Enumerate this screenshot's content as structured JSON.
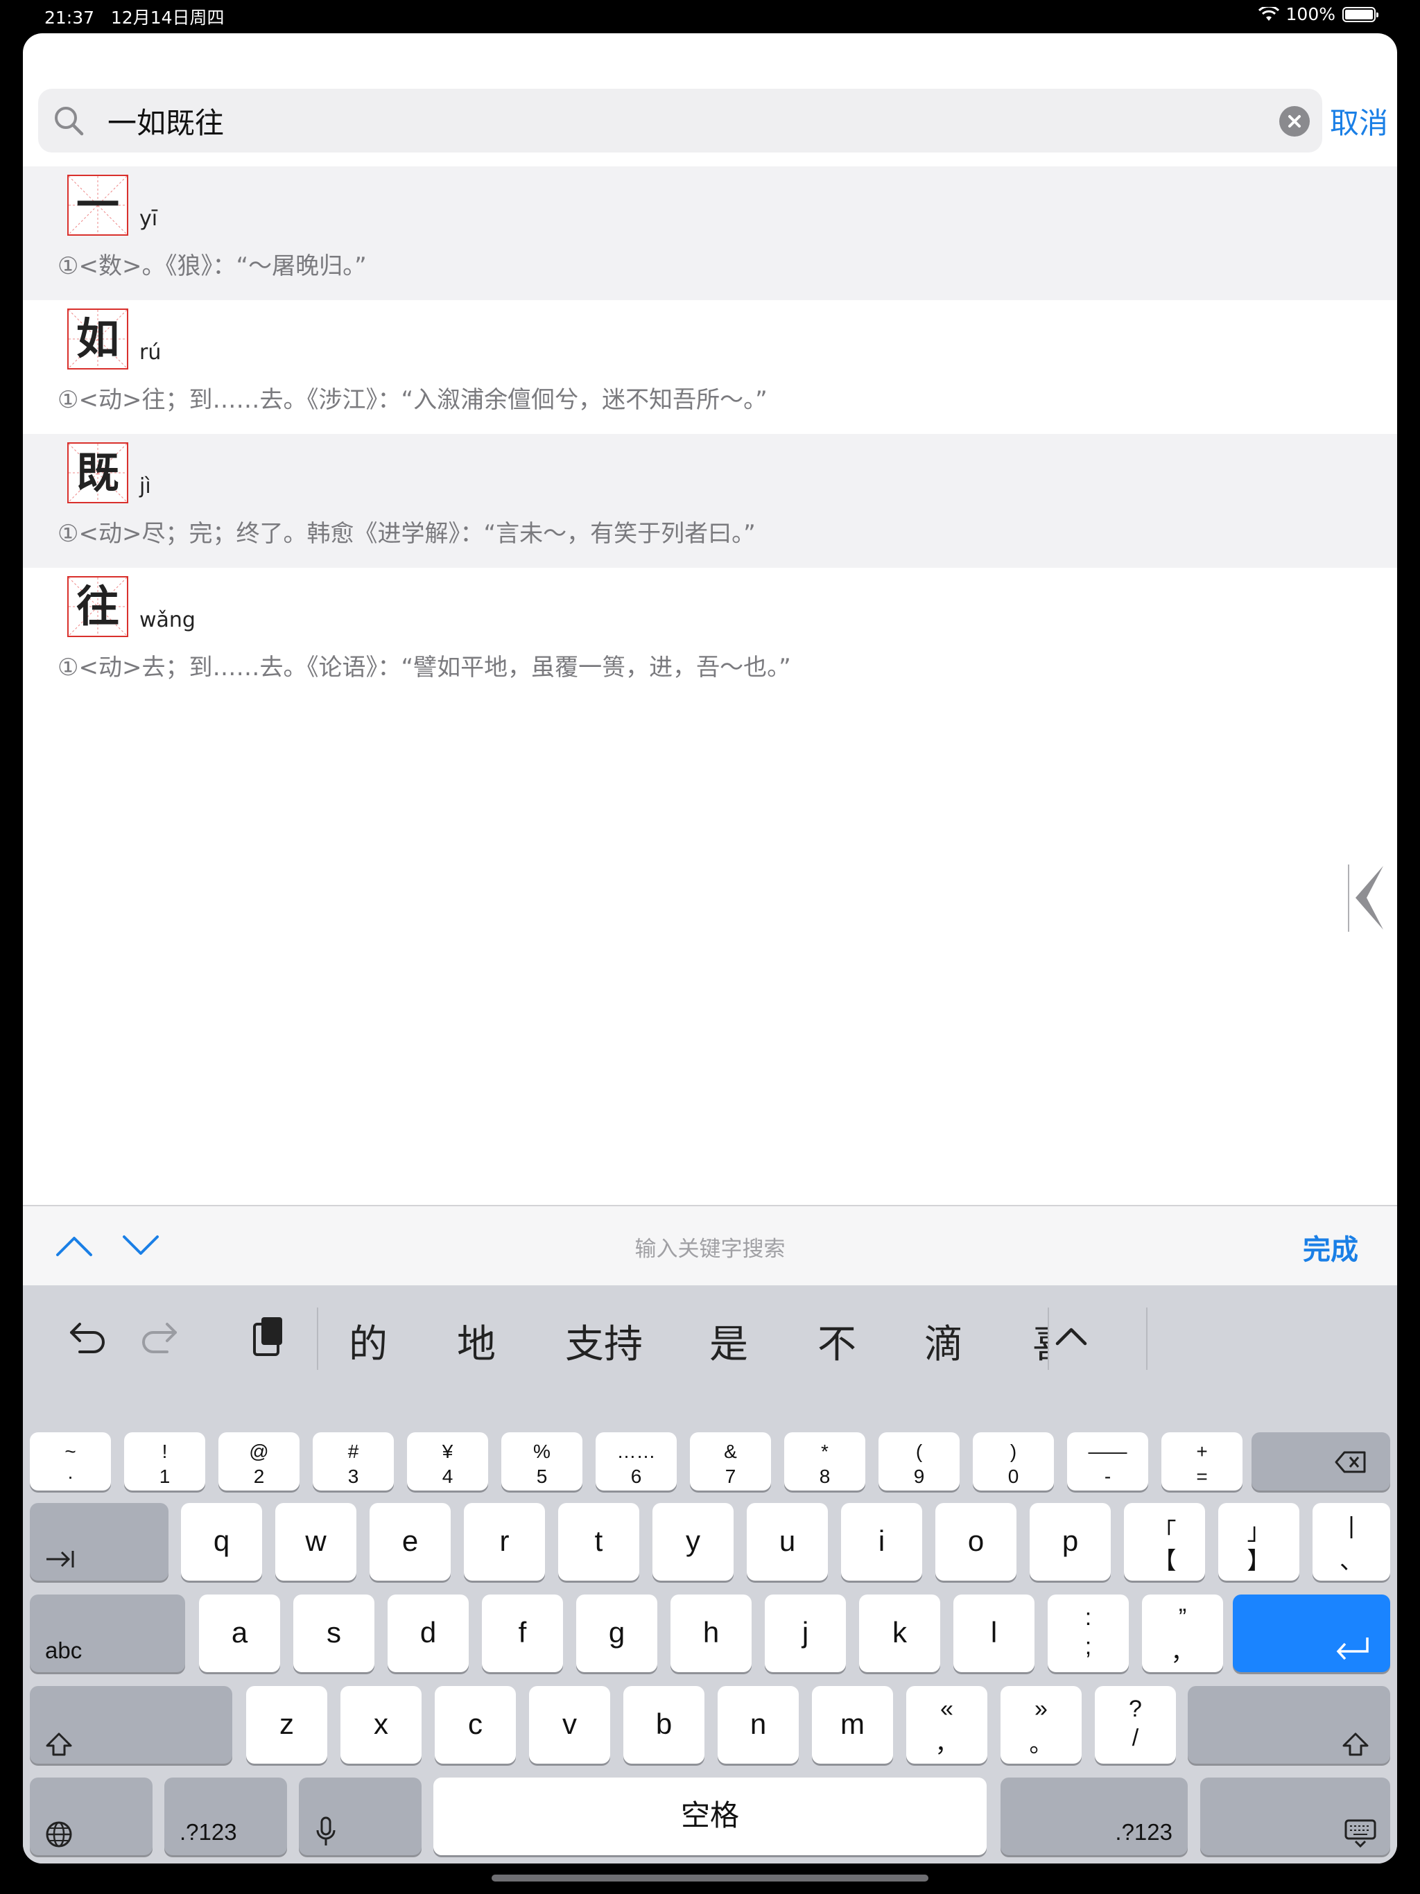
{
  "status_bar": {
    "time": "21:37",
    "date": "12月14日周四",
    "battery_percent": "100%"
  },
  "search": {
    "query": "一如既往",
    "cancel_label": "取消"
  },
  "results": [
    {
      "character": "一",
      "pinyin": "yī",
      "definition": "①<数>。《狼》：“～屠晚归。”"
    },
    {
      "character": "如",
      "pinyin": "rú",
      "definition": "①<动>往；到……去。《涉江》：“入溆浦余儃佪兮，迷不知吾所～。”"
    },
    {
      "character": "既",
      "pinyin": "jì",
      "definition": "①<动>尽；完；终了。韩愈《进学解》：“言未～，有笑于列者曰。”"
    },
    {
      "character": "往",
      "pinyin": "wǎng",
      "definition": "①<动>去；到……去。《论语》：“譬如平地，虽覆一篑，进，吾～也。”"
    }
  ],
  "find_bar": {
    "placeholder": "输入关键字搜索",
    "done_label": "完成"
  },
  "keyboard": {
    "suggestions": [
      "的",
      "地",
      "支持",
      "是",
      "不",
      "滴",
      "喜"
    ],
    "number_row": [
      {
        "top": "~",
        "bottom": "·"
      },
      {
        "top": "!",
        "bottom": "1"
      },
      {
        "top": "@",
        "bottom": "2"
      },
      {
        "top": "#",
        "bottom": "3"
      },
      {
        "top": "¥",
        "bottom": "4"
      },
      {
        "top": "%",
        "bottom": "5"
      },
      {
        "top": "……",
        "bottom": "6"
      },
      {
        "top": "&",
        "bottom": "7"
      },
      {
        "top": "*",
        "bottom": "8"
      },
      {
        "top": "(",
        "bottom": "9"
      },
      {
        "top": ")",
        "bottom": "0"
      },
      {
        "top": "——",
        "bottom": "-"
      },
      {
        "top": "+",
        "bottom": "="
      }
    ],
    "row_q": [
      "q",
      "w",
      "e",
      "r",
      "t",
      "y",
      "u",
      "i",
      "o",
      "p"
    ],
    "row_q_extra": [
      {
        "top": "「",
        "bottom": "【"
      },
      {
        "top": "」",
        "bottom": "】"
      },
      {
        "top": "|",
        "bottom": "、"
      }
    ],
    "row_a": [
      "a",
      "s",
      "d",
      "f",
      "g",
      "h",
      "j",
      "k",
      "l"
    ],
    "row_a_extra": [
      {
        "top": ":",
        "bottom": ";"
      },
      {
        "top": "”",
        "bottom": "，"
      }
    ],
    "row_z": [
      "z",
      "x",
      "c",
      "v",
      "b",
      "n",
      "m"
    ],
    "row_z_extra": [
      {
        "top": "«",
        "bottom": "，"
      },
      {
        "top": "»",
        "bottom": "。"
      },
      {
        "top": "?",
        "bottom": "/"
      }
    ],
    "abc_label": "abc",
    "numeric_label": ".?123",
    "space_label": "空格"
  }
}
